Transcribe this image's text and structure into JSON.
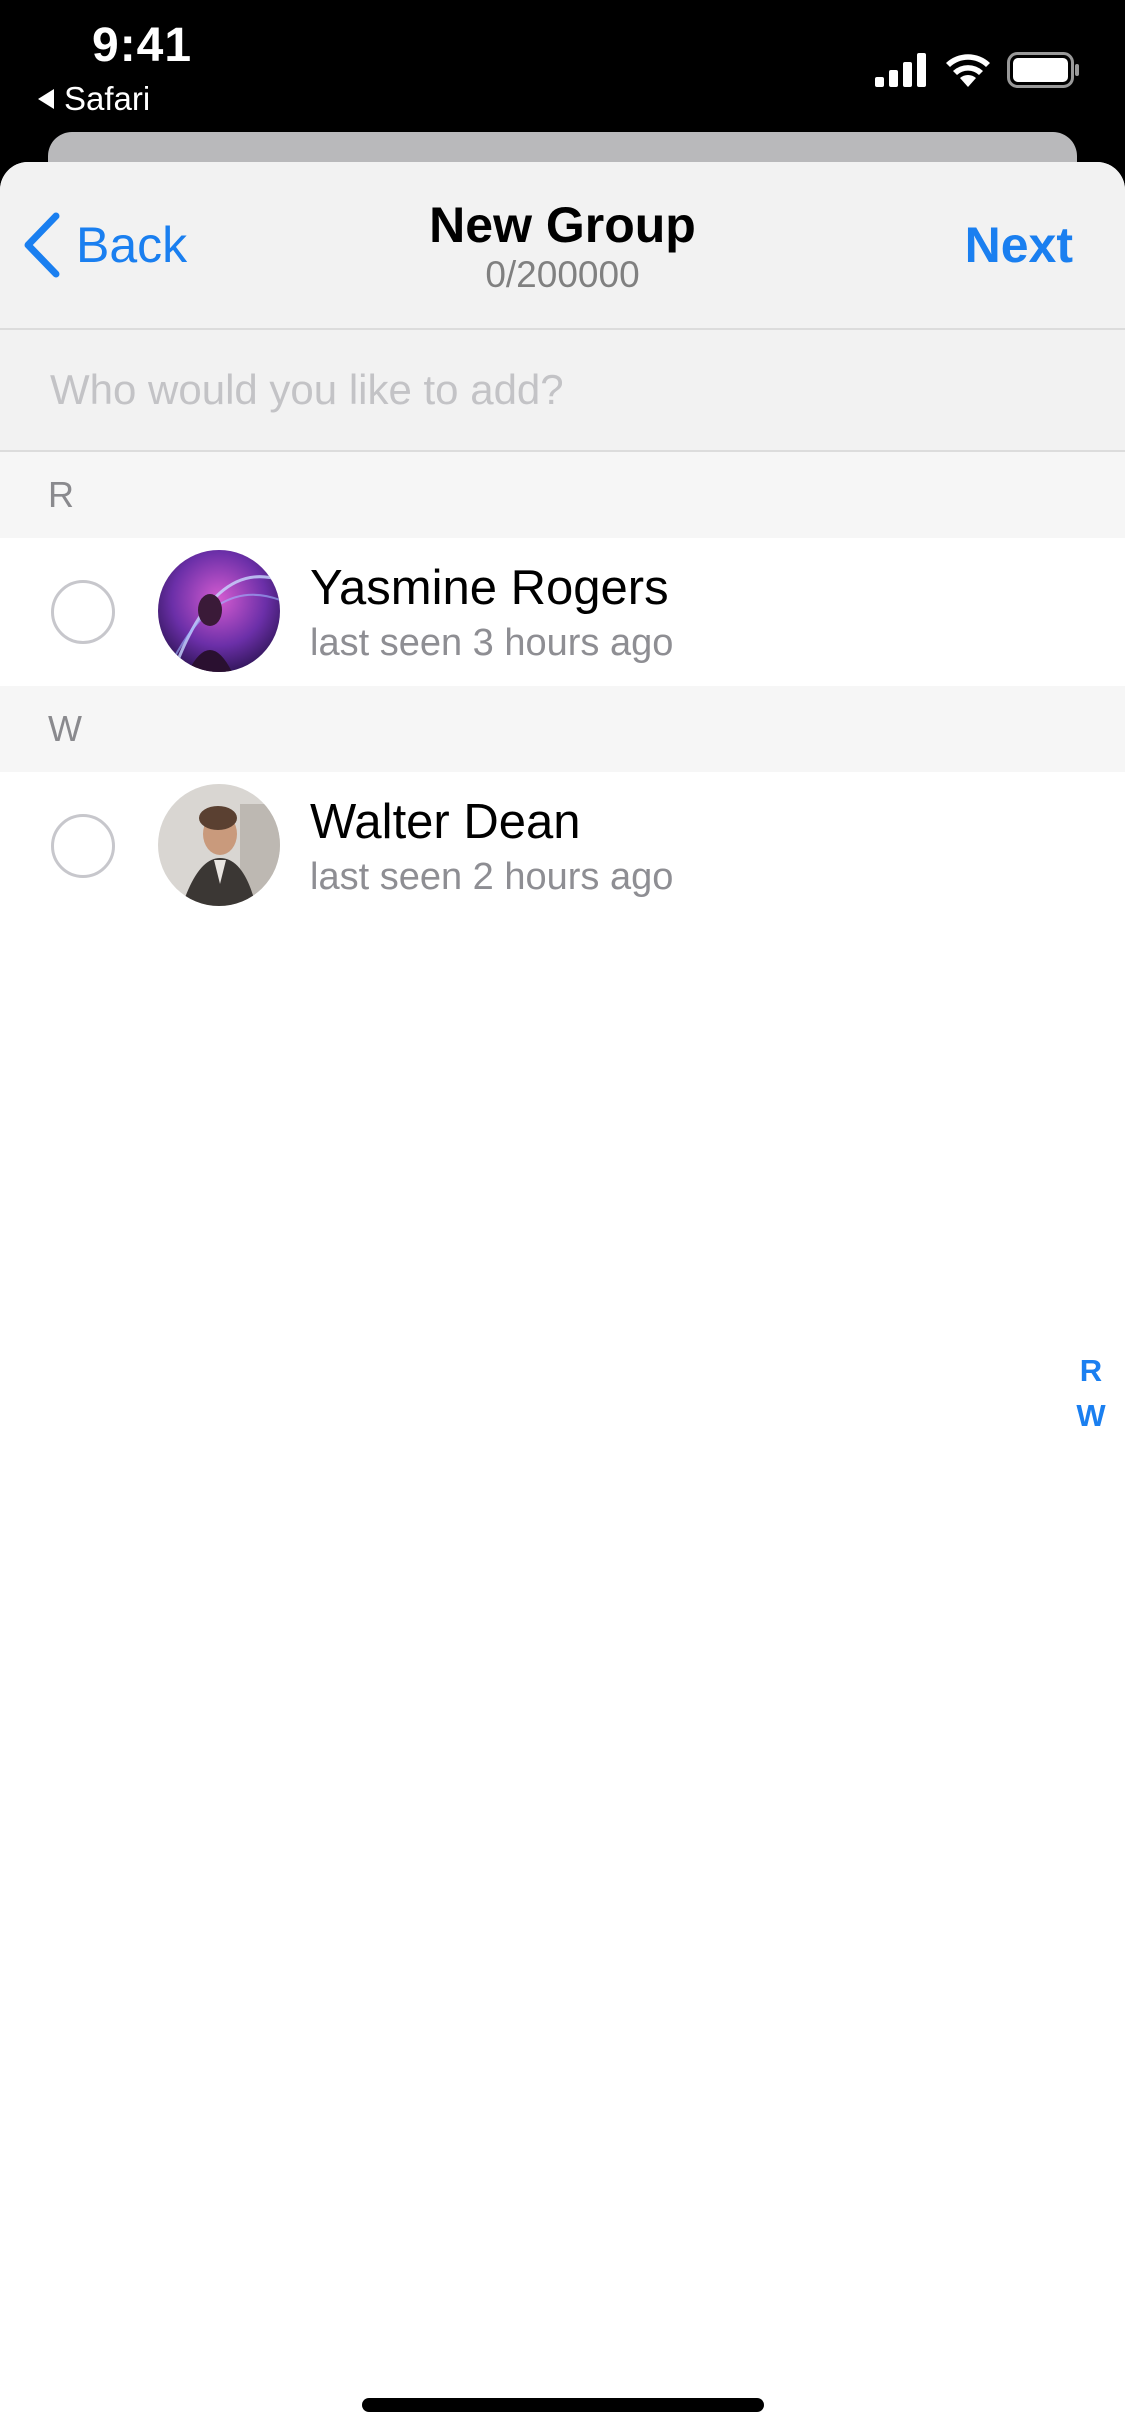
{
  "status_bar": {
    "time": "9:41",
    "back_app_label": "Safari",
    "icons": [
      "cellular-signal-icon",
      "wifi-icon",
      "battery-icon"
    ]
  },
  "nav": {
    "back_label": "Back",
    "title": "New Group",
    "subtitle": "0/200000",
    "next_label": "Next"
  },
  "search": {
    "placeholder": "Who would you like to add?",
    "value": ""
  },
  "sections": [
    {
      "letter": "R",
      "contacts": [
        {
          "name": "Yasmine Rogers",
          "status": "last seen 3 hours ago",
          "selected": false
        }
      ]
    },
    {
      "letter": "W",
      "contacts": [
        {
          "name": "Walter Dean",
          "status": "last seen 2 hours ago",
          "selected": false
        }
      ]
    }
  ],
  "index": [
    "R",
    "W"
  ],
  "colors": {
    "accent": "#1a7ff0",
    "nav_background": "#f2f2f2",
    "secondary_text": "#8e8e93"
  }
}
